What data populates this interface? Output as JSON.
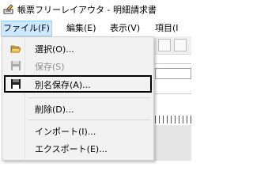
{
  "window": {
    "title": "帳票フリーレイアウタ - 明細請求書",
    "app_icon": "document-pencil-icon"
  },
  "menubar": {
    "items": [
      {
        "label": "ファイル(F)",
        "active": true
      },
      {
        "label": "編集(E)",
        "active": false
      },
      {
        "label": "表示(V)",
        "active": false
      },
      {
        "label": "項目(I",
        "active": false
      }
    ]
  },
  "file_menu": {
    "items": [
      {
        "label": "選択(O)...",
        "icon": "open-folder-icon",
        "enabled": true,
        "highlighted": false
      },
      {
        "label": "保存(S)",
        "icon": "floppy-disk-icon",
        "enabled": false,
        "highlighted": false
      },
      {
        "label": "別名保存(A)...",
        "icon": "floppy-disk-icon",
        "enabled": true,
        "highlighted": true
      },
      {
        "label": "削除(D)...",
        "icon": "",
        "enabled": true,
        "highlighted": false
      },
      {
        "label": "インポート(I)...",
        "icon": "",
        "enabled": true,
        "highlighted": false
      },
      {
        "label": "エクスポート(E)...",
        "icon": "",
        "enabled": true,
        "highlighted": false
      }
    ]
  },
  "colors": {
    "menu_active_bg": "#cce8ff",
    "menu_bg": "#f2f2f2",
    "disabled_text": "#8d8d8d",
    "highlight_border": "#000000"
  }
}
